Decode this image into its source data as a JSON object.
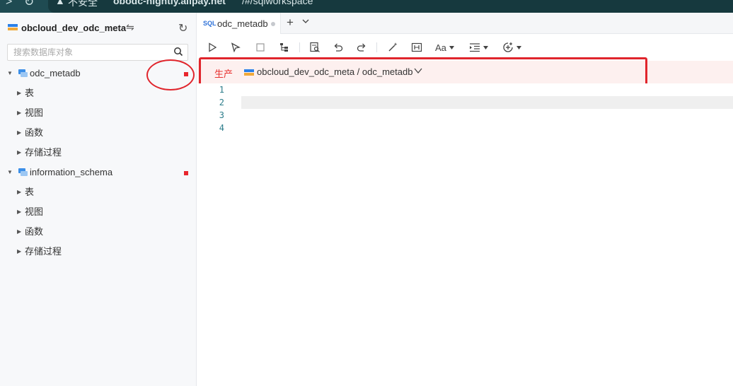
{
  "browser": {
    "security_label": "不安全",
    "host": "obodc-nightly.alipay.net",
    "path": "/#/sqlworkspace"
  },
  "sidebar": {
    "datasource_name": "obcloud_dev_odc_meta",
    "search_placeholder": "搜索数据库对象",
    "databases": [
      {
        "name": "odc_metadb",
        "expanded": true,
        "env_color": "#e8262d",
        "children": [
          "表",
          "视图",
          "函数",
          "存储过程"
        ]
      },
      {
        "name": "information_schema",
        "expanded": true,
        "env_color": "#e8262d",
        "children": [
          "表",
          "视图",
          "函数",
          "存储过程"
        ]
      }
    ]
  },
  "tabs": [
    {
      "badge": "SQL",
      "title": "odc_metadb",
      "unsaved": true
    }
  ],
  "toolbar": {
    "icons": [
      "run-icon",
      "run-selection-icon",
      "stop-icon",
      "plan-icon",
      "format-check-icon",
      "undo-icon",
      "redo-icon",
      "beautify-icon",
      "snippet-icon",
      "case-icon",
      "indent-icon",
      "more-icon"
    ],
    "case_label": "Aa"
  },
  "env_bar": {
    "env_label": "生产",
    "connection_path": "obcloud_dev_odc_meta / odc_metadb",
    "accent": "#e8312f"
  },
  "editor": {
    "line_numbers": [
      "1",
      "2",
      "3",
      "4"
    ],
    "current_line": 2
  }
}
